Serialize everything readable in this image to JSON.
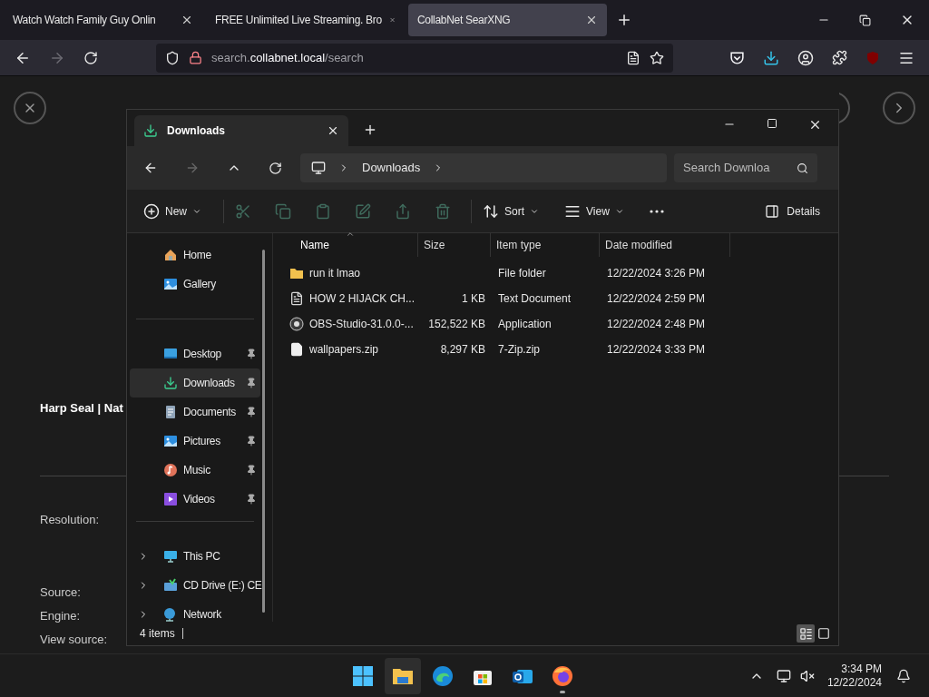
{
  "browser": {
    "tabs": [
      {
        "title": "Watch Watch Family Guy Onlin",
        "selected": false
      },
      {
        "title": "FREE Unlimited Live Streaming. Bro",
        "selected": false
      },
      {
        "title": "CollabNet SearXNG",
        "selected": true
      }
    ],
    "address": {
      "subdomain": "search.",
      "domain": "collabnet.local",
      "path": "/search"
    }
  },
  "page": {
    "title": "Harp Seal | Nat",
    "fields": [
      "Resolution:",
      "Source:",
      "Engine:",
      "View source:"
    ]
  },
  "explorer": {
    "tab": "Downloads",
    "breadcrumb": "Downloads",
    "search_placeholder": "Search Downloa",
    "toolbar": [
      {
        "kind": "new",
        "label": "New",
        "disabled": false
      },
      {
        "kind": "cut",
        "disabled": true
      },
      {
        "kind": "copy",
        "disabled": true
      },
      {
        "kind": "paste",
        "disabled": true
      },
      {
        "kind": "rename",
        "disabled": true
      },
      {
        "kind": "share",
        "disabled": true
      },
      {
        "kind": "delete",
        "disabled": true
      },
      {
        "kind": "sort",
        "label": "Sort",
        "disabled": false
      },
      {
        "kind": "view",
        "label": "View",
        "disabled": false
      },
      {
        "kind": "more",
        "disabled": false
      }
    ],
    "details_label": "Details",
    "sidebar": [
      [
        {
          "kind": "home",
          "label": "Home",
          "pinned": false,
          "selected": false
        },
        {
          "kind": "gallery",
          "label": "Gallery",
          "pinned": false,
          "selected": false
        }
      ],
      [
        {
          "kind": "desktop",
          "label": "Desktop",
          "pinned": true,
          "selected": false
        },
        {
          "kind": "downloads",
          "label": "Downloads",
          "pinned": true,
          "selected": true
        },
        {
          "kind": "documents",
          "label": "Documents",
          "pinned": true,
          "selected": false
        },
        {
          "kind": "pictures",
          "label": "Pictures",
          "pinned": true,
          "selected": false
        },
        {
          "kind": "music",
          "label": "Music",
          "pinned": true,
          "selected": false
        },
        {
          "kind": "videos",
          "label": "Videos",
          "pinned": true,
          "selected": false
        }
      ],
      [
        {
          "kind": "pc",
          "label": "This PC",
          "pinned": false,
          "selected": false,
          "expanded": false
        },
        {
          "kind": "cd",
          "label": "CD Drive (E:) CE",
          "pinned": false,
          "selected": false,
          "expanded": false
        },
        {
          "kind": "network",
          "label": "Network",
          "pinned": false,
          "selected": false,
          "expanded": false
        }
      ]
    ],
    "columns": [
      {
        "label": "Name",
        "sorted": true
      },
      {
        "label": "Size",
        "sorted": false
      },
      {
        "label": "Item type",
        "sorted": false
      },
      {
        "label": "Date modified",
        "sorted": false
      }
    ],
    "rows": [
      {
        "kind": "folder",
        "name": "run it lmao",
        "size": "",
        "type": "File folder",
        "date": "12/22/2024 3:26 PM"
      },
      {
        "kind": "text",
        "name": "HOW 2 HIJACK CH...",
        "size": "1 KB",
        "type": "Text Document",
        "date": "12/22/2024 2:59 PM"
      },
      {
        "kind": "app",
        "name": "OBS-Studio-31.0.0-...",
        "size": "152,522 KB",
        "type": "Application",
        "date": "12/22/2024 2:48 PM"
      },
      {
        "kind": "zip",
        "name": "wallpapers.zip",
        "size": "8,297 KB",
        "type": "7-Zip.zip",
        "date": "12/22/2024 3:33 PM"
      }
    ],
    "status": "4 items",
    "views": [
      {
        "kind": "details",
        "selected": true
      },
      {
        "kind": "tiles",
        "selected": false
      }
    ]
  },
  "taskbar": {
    "apps": [
      {
        "kind": "start",
        "selected": false,
        "running": false
      },
      {
        "kind": "explorer",
        "selected": true,
        "running": false
      },
      {
        "kind": "edge",
        "selected": false,
        "running": false
      },
      {
        "kind": "store",
        "selected": false,
        "running": false
      },
      {
        "kind": "outlook",
        "selected": false,
        "running": false
      },
      {
        "kind": "firefox",
        "selected": false,
        "running": true
      }
    ],
    "time": "3:34 PM",
    "date": "12/22/2024"
  }
}
